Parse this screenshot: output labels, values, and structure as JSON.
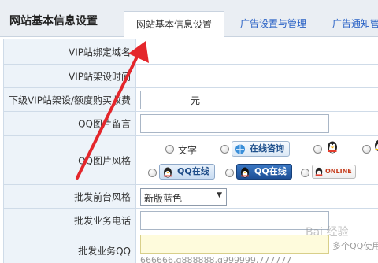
{
  "header": {
    "title": "网站基本信息设置",
    "tabs": [
      {
        "label": "网站基本信息设置",
        "active": true
      },
      {
        "label": "广告设置与管理",
        "active": false
      },
      {
        "label": "广告通知管",
        "active": false
      }
    ]
  },
  "form": {
    "domain_label": "VIP站绑定域名",
    "setup_time_label": "VIP站架设时间",
    "fee_label": "下级VIP站架设/额度购买收费",
    "fee_unit": "元",
    "qq_message_label": "QQ图片留言",
    "qq_style_label": "QQ图片风格",
    "qq_styles": [
      {
        "label": "文字"
      },
      {
        "label": "在线咨询"
      },
      {
        "label": "QQ在线"
      },
      {
        "label": "QQ在线"
      },
      {
        "label": "ONLINE"
      }
    ],
    "front_style_label": "批发前台风格",
    "front_style_value": "新版蓝色",
    "phone_label": "批发业务电话",
    "qq_label": "批发业务QQ",
    "qq_hint": "多个QQ使用",
    "qq_example": "666666,q888888,q999999,777777"
  },
  "watermark": "Bai 经验",
  "colors": {
    "arrow": "#e4262b",
    "link": "#2b63c6",
    "label_bg": "#edf3f9"
  }
}
